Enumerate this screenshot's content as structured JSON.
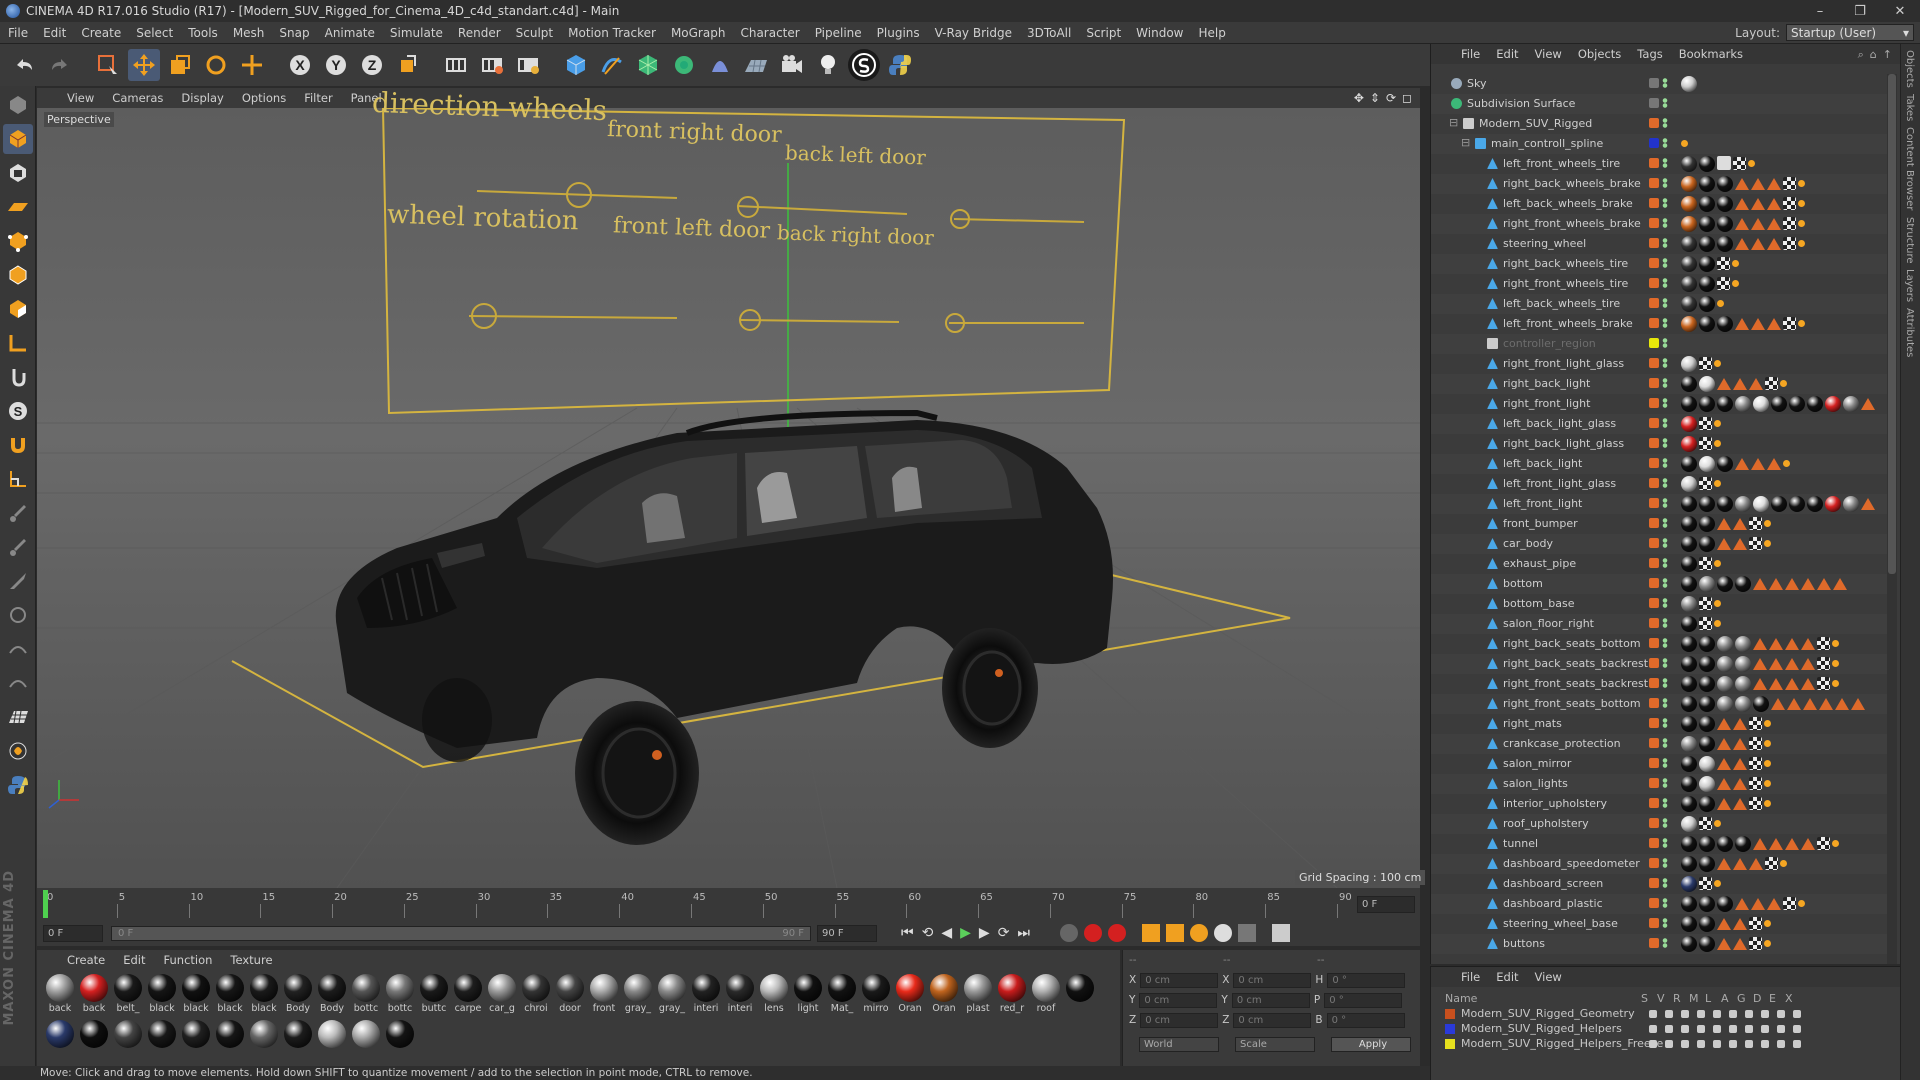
{
  "window": {
    "title": "CINEMA 4D R17.016 Studio (R17) - [Modern_SUV_Rigged_for_Cinema_4D_c4d_standart.c4d] - Main",
    "controls": [
      "–",
      "❐",
      "✕"
    ]
  },
  "menubar": {
    "items": [
      "File",
      "Edit",
      "Create",
      "Select",
      "Tools",
      "Mesh",
      "Snap",
      "Animate",
      "Simulate",
      "Render",
      "Sculpt",
      "Motion Tracker",
      "MoGraph",
      "Character",
      "Pipeline",
      "Plugins",
      "V-Ray Bridge",
      "3DToAll",
      "Script",
      "Window",
      "Help"
    ],
    "layout_label": "Layout:",
    "layout_value": "Startup (User)"
  },
  "viewport": {
    "menu": [
      "View",
      "Cameras",
      "Display",
      "Options",
      "Filter",
      "Panel"
    ],
    "camera_label": "Perspective",
    "grid_spacing": "Grid Spacing : 100 cm",
    "controller_labels": [
      "direction wheels",
      "front right door",
      "back left door",
      "wheel rotation",
      "front left door",
      "back right door"
    ]
  },
  "timeline": {
    "ticks": [
      "0",
      "5",
      "10",
      "15",
      "20",
      "25",
      "30",
      "35",
      "40",
      "45",
      "50",
      "55",
      "60",
      "65",
      "70",
      "75",
      "80",
      "85",
      "90"
    ],
    "end_field": "0 F",
    "start_field": "0 F",
    "range_start": "0 F",
    "range_end": "90 F",
    "max_field": "90 F"
  },
  "materials": {
    "menu": [
      "Create",
      "Edit",
      "Function",
      "Texture"
    ],
    "row1": [
      {
        "name": "back",
        "color": "#a0a0a0"
      },
      {
        "name": "back",
        "color": "#d42020"
      },
      {
        "name": "belt_",
        "color": "#1a1a1a"
      },
      {
        "name": "black",
        "color": "#151515"
      },
      {
        "name": "black",
        "color": "#111"
      },
      {
        "name": "black",
        "color": "#161616"
      },
      {
        "name": "black",
        "color": "#1a1a1a"
      },
      {
        "name": "Body",
        "color": "#222"
      },
      {
        "name": "Body",
        "color": "#1c1c1c"
      },
      {
        "name": "bottc",
        "color": "#555"
      },
      {
        "name": "bottc",
        "color": "#777"
      },
      {
        "name": "buttc",
        "color": "#1a1a1a"
      },
      {
        "name": "carpe",
        "color": "#1e1e1e"
      },
      {
        "name": "car_g",
        "color": "#9a9a9a"
      },
      {
        "name": "chroi",
        "color": "#333"
      },
      {
        "name": "door",
        "color": "#444"
      },
      {
        "name": "front",
        "color": "#aaa"
      },
      {
        "name": "gray_",
        "color": "#888"
      },
      {
        "name": "gray_",
        "color": "#8a8a8a"
      },
      {
        "name": "interi",
        "color": "#222"
      },
      {
        "name": "interi",
        "color": "#2a2a2a"
      },
      {
        "name": "lens",
        "color": "#bbb"
      },
      {
        "name": "light",
        "color": "#111"
      },
      {
        "name": "Mat_",
        "color": "#121212"
      },
      {
        "name": "mirro",
        "color": "#1a1a1a"
      },
      {
        "name": "Oran",
        "color": "#e82a1a"
      },
      {
        "name": "Oran",
        "color": "#c0641e"
      },
      {
        "name": "plast",
        "color": "#999"
      },
      {
        "name": "red_r",
        "color": "#c81c1c"
      },
      {
        "name": "roof",
        "color": "#b0b0b0"
      }
    ],
    "row2": [
      {
        "name": "",
        "color": "#111"
      },
      {
        "name": "",
        "color": "#2a3a6a"
      },
      {
        "name": "",
        "color": "#0e0e0e"
      },
      {
        "name": "",
        "color": "#444"
      },
      {
        "name": "",
        "color": "#181818"
      },
      {
        "name": "",
        "color": "#202020"
      },
      {
        "name": "",
        "color": "#161616"
      },
      {
        "name": "",
        "color": "#666"
      },
      {
        "name": "",
        "color": "#1c1c1c"
      },
      {
        "name": "",
        "color": "#bbb"
      },
      {
        "name": "",
        "color": "#aaa"
      },
      {
        "name": "",
        "color": "#141414"
      }
    ]
  },
  "coords": {
    "header": [
      "--",
      "--",
      "--"
    ],
    "rows": [
      {
        "a": "X",
        "av": "0 cm",
        "b": "X",
        "bv": "0 cm",
        "c": "H",
        "cv": "0 °"
      },
      {
        "a": "Y",
        "av": "0 cm",
        "b": "Y",
        "bv": "0 cm",
        "c": "P",
        "cv": "0 °"
      },
      {
        "a": "Z",
        "av": "0 cm",
        "b": "Z",
        "bv": "0 cm",
        "c": "B",
        "cv": "0 °"
      }
    ],
    "world": "World",
    "scale": "Scale",
    "apply": "Apply"
  },
  "objects": {
    "menu": [
      "File",
      "Edit",
      "View",
      "Objects",
      "Tags",
      "Bookmarks"
    ],
    "items": [
      {
        "name": "Sky",
        "indent": 0,
        "icon": "sky",
        "flagcolor": "#777",
        "tags": "s"
      },
      {
        "name": "Subdivision Surface",
        "indent": 0,
        "icon": "subd",
        "flagcolor": "#777",
        "tags": ""
      },
      {
        "name": "Modern_SUV_Rigged",
        "indent": 1,
        "icon": "null",
        "flagcolor": "#e06a2a",
        "tags": ""
      },
      {
        "name": "main_controll_spline",
        "indent": 2,
        "icon": "spline",
        "flagcolor": "#2233cc",
        "tags": "p"
      },
      {
        "name": "left_front_wheels_tire",
        "indent": 3,
        "icon": "obj",
        "flagcolor": "#e06a2a",
        "tags": "dbkcp"
      },
      {
        "name": "right_back_wheels_brake",
        "indent": 3,
        "icon": "obj",
        "flagcolor": "#e06a2a",
        "tags": "obbtttcp"
      },
      {
        "name": "left_back_wheels_brake",
        "indent": 3,
        "icon": "obj",
        "flagcolor": "#e06a2a",
        "tags": "obbtttcp"
      },
      {
        "name": "right_front_wheels_brake",
        "indent": 3,
        "icon": "obj",
        "flagcolor": "#e06a2a",
        "tags": "obbtttcp"
      },
      {
        "name": "steering_wheel",
        "indent": 3,
        "icon": "obj",
        "flagcolor": "#e06a2a",
        "tags": "dbbtttcp"
      },
      {
        "name": "right_back_wheels_tire",
        "indent": 3,
        "icon": "obj",
        "flagcolor": "#e06a2a",
        "tags": "dbcp"
      },
      {
        "name": "right_front_wheels_tire",
        "indent": 3,
        "icon": "obj",
        "flagcolor": "#e06a2a",
        "tags": "dbcp"
      },
      {
        "name": "left_back_wheels_tire",
        "indent": 3,
        "icon": "obj",
        "flagcolor": "#e06a2a",
        "tags": "dbp"
      },
      {
        "name": "left_front_wheels_brake",
        "indent": 3,
        "icon": "obj",
        "flagcolor": "#e06a2a",
        "tags": "obbtttcp"
      },
      {
        "name": "controller_region",
        "indent": 3,
        "icon": "null",
        "flagcolor": "#e8e80a",
        "tags": "",
        "dim": true
      },
      {
        "name": "right_front_light_glass",
        "indent": 3,
        "icon": "obj",
        "flagcolor": "#e06a2a",
        "tags": "scp"
      },
      {
        "name": "right_back_light",
        "indent": 3,
        "icon": "obj",
        "flagcolor": "#e06a2a",
        "tags": "bwtttcp"
      },
      {
        "name": "right_front_light",
        "indent": 3,
        "icon": "obj",
        "flagcolor": "#e06a2a",
        "tags": "bbbgwbbbrgt"
      },
      {
        "name": "left_back_light_glass",
        "indent": 3,
        "icon": "obj",
        "flagcolor": "#e06a2a",
        "tags": "rcp"
      },
      {
        "name": "right_back_light_glass",
        "indent": 3,
        "icon": "obj",
        "flagcolor": "#e06a2a",
        "tags": "rcp"
      },
      {
        "name": "left_back_light",
        "indent": 3,
        "icon": "obj",
        "flagcolor": "#e06a2a",
        "tags": "bwbtttp"
      },
      {
        "name": "left_front_light_glass",
        "indent": 3,
        "icon": "obj",
        "flagcolor": "#e06a2a",
        "tags": "scp"
      },
      {
        "name": "left_front_light",
        "indent": 3,
        "icon": "obj",
        "flagcolor": "#e06a2a",
        "tags": "bbbgwbbbrgt"
      },
      {
        "name": "front_bumper",
        "indent": 3,
        "icon": "obj",
        "flagcolor": "#e06a2a",
        "tags": "bbttcp"
      },
      {
        "name": "car_body",
        "indent": 3,
        "icon": "obj",
        "flagcolor": "#e06a2a",
        "tags": "bbttcp"
      },
      {
        "name": "exhaust_pipe",
        "indent": 3,
        "icon": "obj",
        "flagcolor": "#e06a2a",
        "tags": "bcp"
      },
      {
        "name": "bottom",
        "indent": 3,
        "icon": "obj",
        "flagcolor": "#e06a2a",
        "tags": "bgbbtttttt"
      },
      {
        "name": "bottom_base",
        "indent": 3,
        "icon": "obj",
        "flagcolor": "#e06a2a",
        "tags": "gcp"
      },
      {
        "name": "salon_floor_right",
        "indent": 3,
        "icon": "obj",
        "flagcolor": "#e06a2a",
        "tags": "bcp"
      },
      {
        "name": "right_back_seats_bottom",
        "indent": 3,
        "icon": "obj",
        "flagcolor": "#e06a2a",
        "tags": "bbggttttcp"
      },
      {
        "name": "right_back_seats_backrest",
        "indent": 3,
        "icon": "obj",
        "flagcolor": "#e06a2a",
        "tags": "bbggttttcp"
      },
      {
        "name": "right_front_seats_backrest",
        "indent": 3,
        "icon": "obj",
        "flagcolor": "#e06a2a",
        "tags": "bbggttttcp"
      },
      {
        "name": "right_front_seats_bottom",
        "indent": 3,
        "icon": "obj",
        "flagcolor": "#e06a2a",
        "tags": "bbggbtttttt"
      },
      {
        "name": "right_mats",
        "indent": 3,
        "icon": "obj",
        "flagcolor": "#e06a2a",
        "tags": "bbttcp"
      },
      {
        "name": "crankcase_protection",
        "indent": 3,
        "icon": "obj",
        "flagcolor": "#e06a2a",
        "tags": "gbttcp"
      },
      {
        "name": "salon_mirror",
        "indent": 3,
        "icon": "obj",
        "flagcolor": "#e06a2a",
        "tags": "bsttcp"
      },
      {
        "name": "salon_lights",
        "indent": 3,
        "icon": "obj",
        "flagcolor": "#e06a2a",
        "tags": "bsttcp"
      },
      {
        "name": "interior_upholstery",
        "indent": 3,
        "icon": "obj",
        "flagcolor": "#e06a2a",
        "tags": "bbttcp"
      },
      {
        "name": "roof_upholstery",
        "indent": 3,
        "icon": "obj",
        "flagcolor": "#e06a2a",
        "tags": "scp"
      },
      {
        "name": "tunnel",
        "indent": 3,
        "icon": "obj",
        "flagcolor": "#e06a2a",
        "tags": "bbbbttttcp"
      },
      {
        "name": "dashboard_speedometer",
        "indent": 3,
        "icon": "obj",
        "flagcolor": "#e06a2a",
        "tags": "bbtttcp"
      },
      {
        "name": "dashboard_screen",
        "indent": 3,
        "icon": "obj",
        "flagcolor": "#e06a2a",
        "tags": "ucp"
      },
      {
        "name": "dashboard_plastic",
        "indent": 3,
        "icon": "obj",
        "flagcolor": "#e06a2a",
        "tags": "bbbtttcp"
      },
      {
        "name": "steering_wheel_base",
        "indent": 3,
        "icon": "obj",
        "flagcolor": "#e06a2a",
        "tags": "bbttcp"
      },
      {
        "name": "buttons",
        "indent": 3,
        "icon": "obj",
        "flagcolor": "#e06a2a",
        "tags": "bbttcp"
      }
    ]
  },
  "layers": {
    "menu": [
      "File",
      "Edit",
      "View"
    ],
    "headers": [
      "Name",
      "S",
      "V",
      "R",
      "M",
      "L",
      "A",
      "G",
      "D",
      "E",
      "X"
    ],
    "items": [
      {
        "name": "Modern_SUV_Rigged_Geometry",
        "color": "#c8501e"
      },
      {
        "name": "Modern_SUV_Rigged_Helpers",
        "color": "#2a3ad8"
      },
      {
        "name": "Modern_SUV_Rigged_Helpers_Freeze",
        "color": "#e6e01e"
      }
    ]
  },
  "right_tabs": [
    "Objects",
    "Takes",
    "Content Browser",
    "Structure",
    "Layers",
    "Attributes"
  ],
  "status": "Move: Click and drag to move elements. Hold down SHIFT to quantize movement / add to the selection in point mode, CTRL to remove."
}
